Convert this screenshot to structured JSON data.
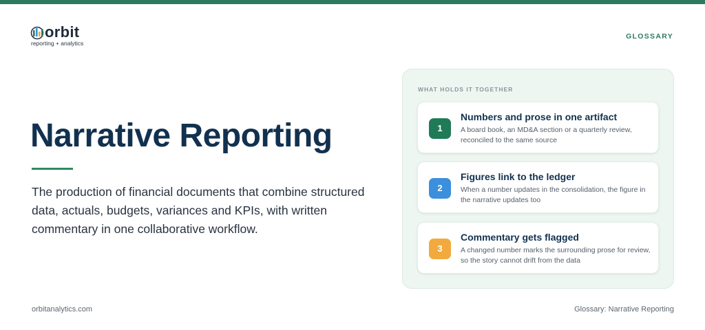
{
  "brand": {
    "wordmark": "orbit",
    "tagline": "reporting + analytics",
    "accent_color": "#2f7a5f",
    "mark_colors": [
      "#2f7a5f",
      "#3a8fd9",
      "#f0a63a"
    ]
  },
  "nav": {
    "glossary_label": "GLOSSARY"
  },
  "hero": {
    "title": "Narrative Reporting",
    "description": "The production of financial documents that combine structured data, actuals, budgets, variances and KPIs, with written commentary in one collaborative workflow."
  },
  "panel": {
    "heading": "WHAT HOLDS IT TOGETHER",
    "items": [
      {
        "number": "1",
        "title": "Numbers and prose in one artifact",
        "body": "A board book, an MD&A section or a quarterly review, reconciled to the same source",
        "badge_color": "#1f7a57"
      },
      {
        "number": "2",
        "title": "Figures link to the ledger",
        "body": "When a number updates in the consolidation, the figure in the narrative updates too",
        "badge_color": "#3b8fdc"
      },
      {
        "number": "3",
        "title": "Commentary gets flagged",
        "body": "A changed number marks the surrounding prose for review, so the story cannot drift from the data",
        "badge_color": "#f2aa3e"
      }
    ]
  },
  "footer": {
    "site": "orbitanalytics.com",
    "page_label": "Glossary: Narrative Reporting"
  }
}
